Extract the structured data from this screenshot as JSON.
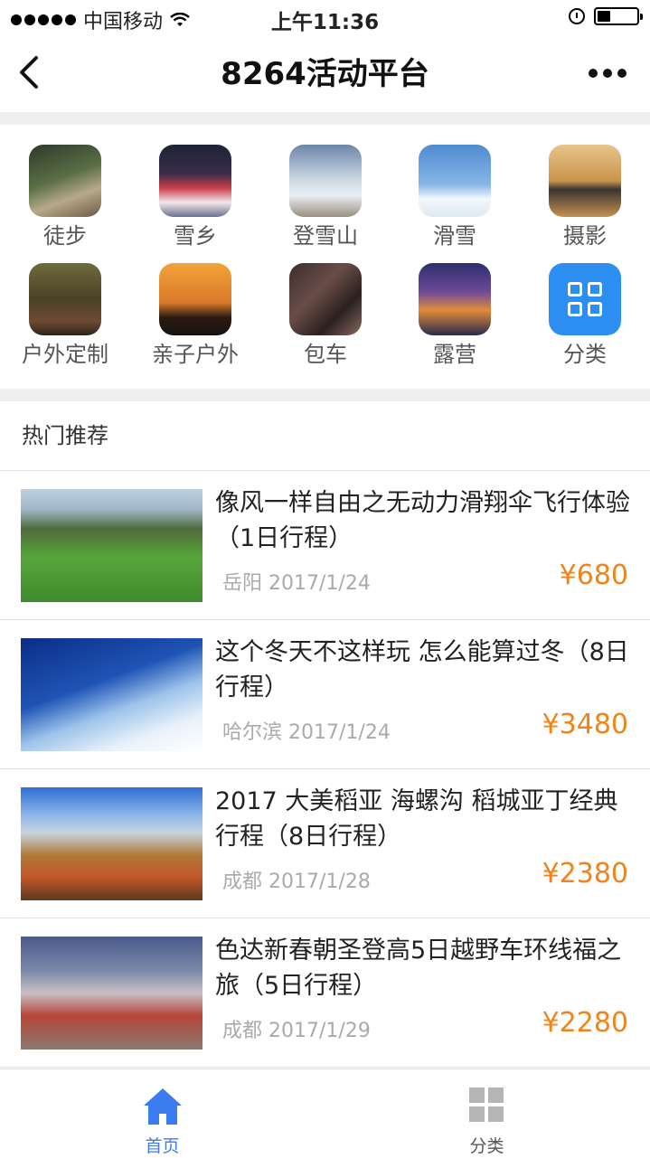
{
  "status_bar": {
    "carrier": "中国移动",
    "time": "上午11:36"
  },
  "navbar": {
    "title": "8264活动平台"
  },
  "categories": [
    {
      "label": "徒步",
      "icon": "hiking-photo-icon"
    },
    {
      "label": "雪乡",
      "icon": "snow-village-photo-icon"
    },
    {
      "label": "登雪山",
      "icon": "snow-mountain-photo-icon"
    },
    {
      "label": "滑雪",
      "icon": "ski-photo-icon"
    },
    {
      "label": "摄影",
      "icon": "camera-photo-icon"
    },
    {
      "label": "户外定制",
      "icon": "outdoor-custom-photo-icon"
    },
    {
      "label": "亲子户外",
      "icon": "family-photo-icon"
    },
    {
      "label": "包车",
      "icon": "car-charter-photo-icon"
    },
    {
      "label": "露营",
      "icon": "camping-photo-icon"
    },
    {
      "label": "分类",
      "icon": "grid-icon"
    }
  ],
  "section": {
    "title": "热门推荐"
  },
  "items": [
    {
      "title": "像风一样自由之无动力滑翔伞飞行体验（1日行程）",
      "location": "岳阳",
      "date": "2017/1/24",
      "price": "¥680"
    },
    {
      "title": "这个冬天不这样玩 怎么能算过冬（8日行程）",
      "location": "哈尔滨",
      "date": "2017/1/24",
      "price": "¥3480"
    },
    {
      "title": "2017 大美稻亚 海螺沟 稻城亚丁经典行程（8日行程）",
      "location": "成都",
      "date": "2017/1/28",
      "price": "¥2380"
    },
    {
      "title": "色达新春朝圣登高5日越野车环线福之旅（5日行程）",
      "location": "成都",
      "date": "2017/1/29",
      "price": "¥2280"
    }
  ],
  "tabbar": {
    "home_label": "首页",
    "category_label": "分类"
  },
  "colors": {
    "accent": "#3b7cf0",
    "price": "#f08419",
    "category_button": "#2b8ef0"
  }
}
